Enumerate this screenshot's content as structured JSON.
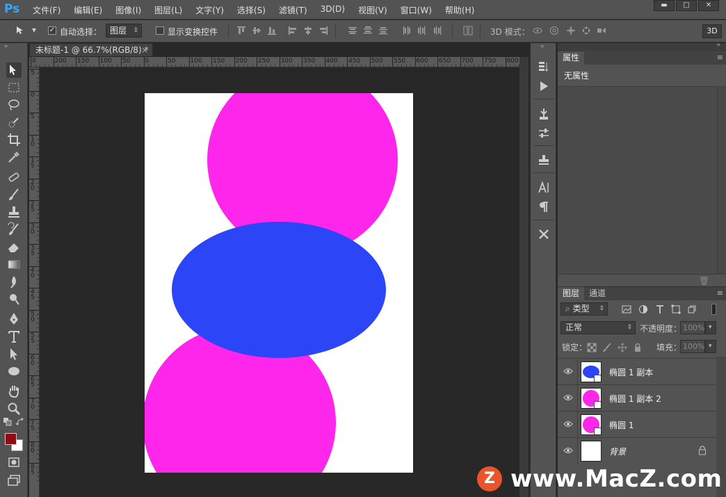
{
  "app": {
    "logo": "Ps",
    "menus": [
      "文件(F)",
      "编辑(E)",
      "图像(I)",
      "图层(L)",
      "文字(Y)",
      "选择(S)",
      "滤镜(T)",
      "3D(D)",
      "视图(V)",
      "窗口(W)",
      "帮助(H)"
    ],
    "window_controls": [
      "▬",
      "□",
      "✕"
    ]
  },
  "options": {
    "auto_select_label": "自动选择：",
    "auto_select_checked": "✓",
    "auto_select_value": "图层",
    "show_transform_label": "显示变换控件",
    "mode_3d_label": "3D 模式：",
    "btn_3d": "3D"
  },
  "document": {
    "tab_title": "未标题-1 @ 66.7%(RGB/8) *",
    "tab_close": "×",
    "ruler_h": [
      "0",
      "200",
      "150",
      "100",
      "50",
      "0",
      "50",
      "100",
      "150",
      "200",
      "250",
      "300",
      "350",
      "400",
      "450",
      "500",
      "550",
      "600",
      "650",
      "700",
      "750",
      "800"
    ],
    "ruler_v": [
      "5",
      "0",
      "5",
      "1 0",
      "1 5",
      "2 0",
      "2 5",
      "3 0",
      "3 5",
      "4 0",
      "4 5",
      "5 0",
      "5 5",
      "6 0",
      "6 5",
      "7 0",
      "7 5",
      "8 0",
      "8 5"
    ],
    "colors": {
      "magenta": "#ff26eb",
      "blue": "#2b45f7",
      "canvas": "#ffffff"
    }
  },
  "toolbox": {
    "foreground": "#8b0c12",
    "background": "#ffffff"
  },
  "properties": {
    "tab": "属性",
    "empty_text": "无属性",
    "menu": "≡"
  },
  "layers": {
    "tabs": [
      "图层",
      "通道"
    ],
    "menu": "≡",
    "filter_kind": "类型",
    "blend_mode": "正常",
    "opacity_label": "不透明度：",
    "opacity_value": "100%",
    "lock_label": "锁定：",
    "fill_label": "填充：",
    "fill_value": "100%",
    "items": [
      {
        "name": "椭圆 1 副本",
        "thumb": "blue"
      },
      {
        "name": "椭圆 1 副本 2",
        "thumb": "magenta"
      },
      {
        "name": "椭圆 1",
        "thumb": "magenta"
      },
      {
        "name": "背景",
        "thumb": "white"
      }
    ]
  },
  "watermark": {
    "logo": "Z",
    "text": "www.MacZ.com"
  }
}
